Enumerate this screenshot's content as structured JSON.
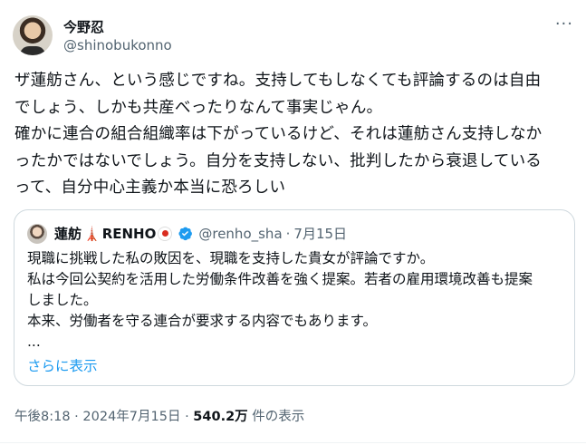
{
  "author": {
    "name": "今野忍",
    "handle": "@shinobukonno"
  },
  "post": {
    "text": "ザ蓮舫さん、という感じですね。支持してもしなくても評論するのは自由\nでしょう、しかも共産べったりなんて事実じゃん。\n確かに連合の組合組織率は下がっているけど、それは蓮舫さん支持しなか\nったかではないでしょう。自分を支持しない、批判したから衰退している\nって、自分中心主義か本当に恐ろしい"
  },
  "quoted": {
    "name": "蓮舫",
    "name_latin": "RENHO",
    "handle": "@renho_sha",
    "sep": "·",
    "date": "7月15日",
    "text": "現職に挑戦した私の敗因を、現職を支持した貴女が評論ですか。\n私は今回公契約を活用した労働条件改善を強く提案。若者の雇用環境改善も提案\nしました。\n本来、労働者を守る連合が要求する内容でもあります。\n...",
    "show_more": "さらに表示"
  },
  "meta": {
    "time": "午後8:18 · 2024年7月15日 · ",
    "views": "540.2万",
    "views_label": " 件の表示"
  },
  "icons": {
    "more": "more-horizontal-icon",
    "verified": "verified-badge-icon",
    "tower": "tokyo-tower-emoji",
    "flag": "japan-flag-emoji"
  },
  "colors": {
    "link": "#1d9bf0",
    "secondary": "#536471",
    "border": "#cfd9de"
  }
}
